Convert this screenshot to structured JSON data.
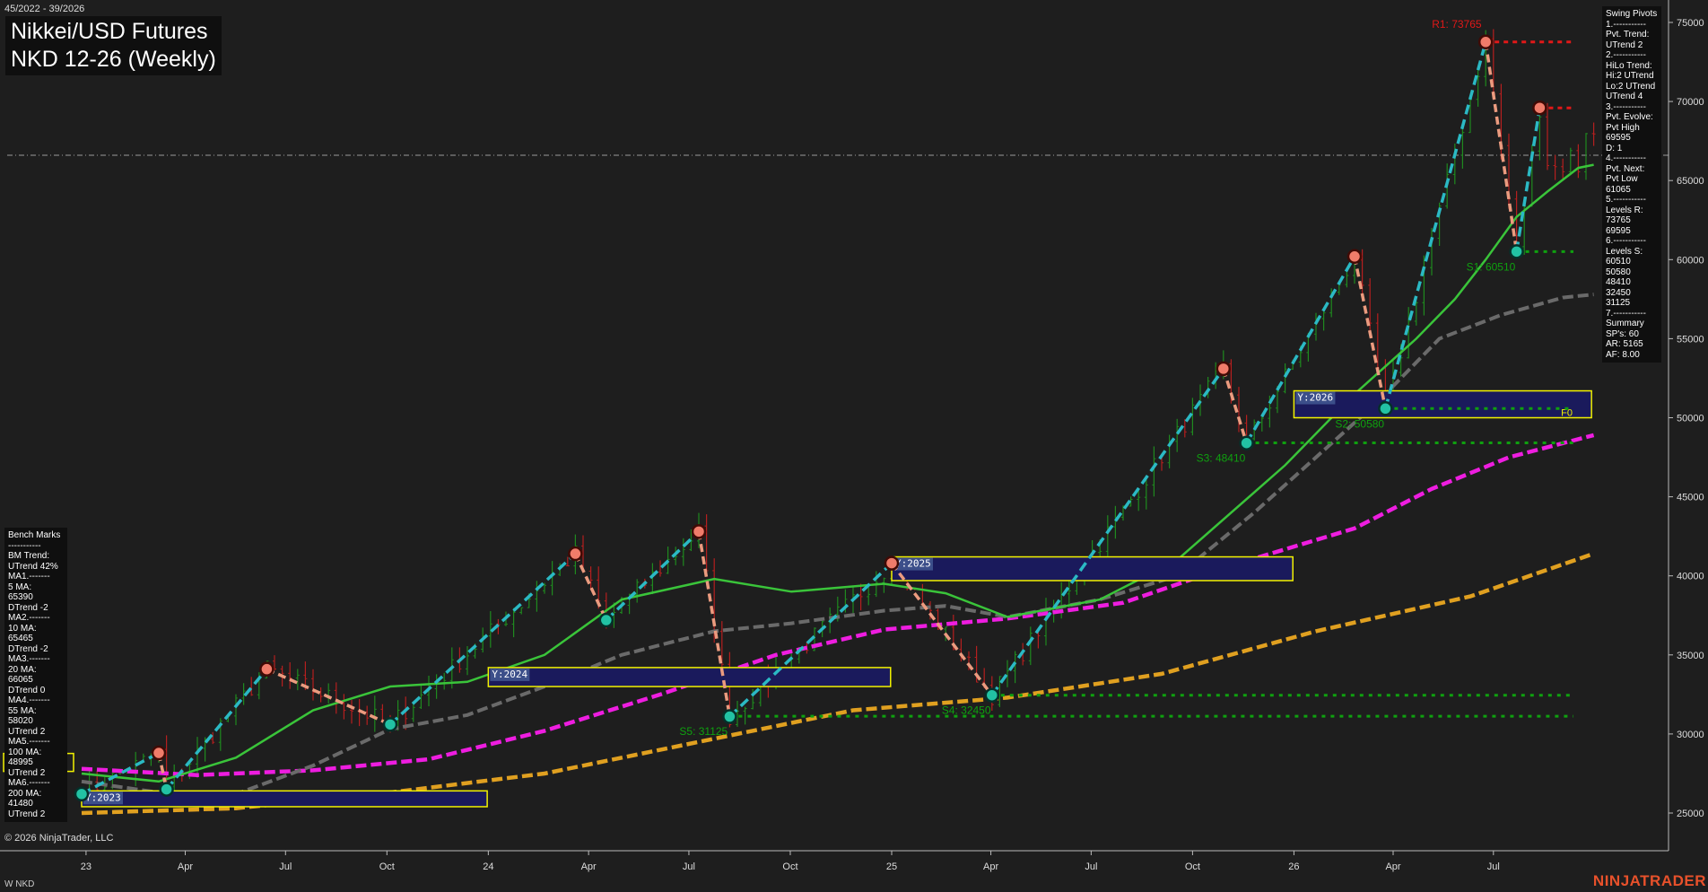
{
  "header": {
    "date_range": "45/2022 - 39/2026",
    "title_line1": "Nikkei/USD Futures",
    "title_line2": "NKD 12-26 (Weekly)"
  },
  "footer": {
    "copyright": "© 2026 NinjaTrader, LLC",
    "instrument": "W NKD",
    "brand": "NINJATRADER"
  },
  "swing_panel": {
    "lines": [
      "Swing Pivots",
      "1.-----------",
      "Pvt. Trend:",
      "UTrend 2",
      "2.-----------",
      "HiLo Trend:",
      "Hi:2 UTrend",
      "Lo:2 UTrend",
      "UTrend 4",
      "3.-----------",
      "Pvt. Evolve:",
      "Pvt High",
      "69595",
      "D: 1",
      "4.-----------",
      "Pvt. Next:",
      "Pvt Low",
      "61065",
      "5.-----------",
      "Levels R:",
      "73765",
      "69595",
      "6.-----------",
      "Levels S:",
      "60510",
      "50580",
      "48410",
      "32450",
      "31125",
      "7.-----------",
      "Summary",
      "SP's: 60",
      "AR: 5165",
      "AF: 8.00"
    ]
  },
  "bench_panel": {
    "lines": [
      "Bench Marks",
      "-----------",
      "BM Trend:",
      "UTrend 42%",
      "MA1.-------",
      "5 MA:",
      "65390",
      "DTrend -2",
      "MA2.-------",
      "10 MA:",
      "65465",
      "DTrend -2",
      "MA3.-------",
      "20 MA:",
      "66065",
      "DTrend 0",
      "MA4.-------",
      "55 MA:",
      "58020",
      "UTrend 2",
      "MA5.-------",
      "100 MA:",
      "48995",
      "UTrend 2",
      "MA6.-------",
      "200 MA:",
      "41480",
      "UTrend 2"
    ]
  },
  "chart_data": {
    "type": "line",
    "title": "NKD 12-26 (Weekly)",
    "ylim": [
      23000,
      76000
    ],
    "y_ticks": [
      25000,
      30000,
      35000,
      40000,
      45000,
      50000,
      55000,
      60000,
      65000,
      70000,
      75000
    ],
    "x_tick_labels": [
      "23",
      "Apr",
      "Jul",
      "Oct",
      "24",
      "Apr",
      "Jul",
      "Oct",
      "25",
      "Apr",
      "Jul",
      "Oct",
      "26",
      "Apr",
      "Jul"
    ],
    "last_price": 66600,
    "colors": {
      "background": "#1e1e1e",
      "up_bar": "#1f8a1f",
      "down_bar": "#b51f1f",
      "ma_fast": "#3ac43a",
      "ma_55": "#6a6a6a",
      "ma_100": "#ee1de0",
      "ma_200": "#e0a020",
      "swing_up": "#2bb9c4",
      "swing_down": "#eb9b7f",
      "resistance": "#e01818",
      "support": "#0fa00f",
      "year_box": "#f2f200",
      "year_fill": "#1a1a5c"
    },
    "swing_pivots": [
      {
        "date": "2022-12-28",
        "value": 26200,
        "type": "low"
      },
      {
        "date": "2023-03-08",
        "value": 28800,
        "type": "high"
      },
      {
        "date": "2023-03-15",
        "value": 26500,
        "type": "low"
      },
      {
        "date": "2023-06-14",
        "value": 34100,
        "type": "high"
      },
      {
        "date": "2023-10-04",
        "value": 30600,
        "type": "low"
      },
      {
        "date": "2024-03-20",
        "value": 41400,
        "type": "high"
      },
      {
        "date": "2024-04-17",
        "value": 37200,
        "type": "low"
      },
      {
        "date": "2024-07-10",
        "value": 42800,
        "type": "high"
      },
      {
        "date": "2024-08-07",
        "value": 31100,
        "type": "low"
      },
      {
        "date": "2025-01-01",
        "value": 40800,
        "type": "high"
      },
      {
        "date": "2025-04-02",
        "value": 32450,
        "type": "low"
      },
      {
        "date": "2025-10-29",
        "value": 53100,
        "type": "high"
      },
      {
        "date": "2025-11-19",
        "value": 48400,
        "type": "low"
      },
      {
        "date": "2026-02-25",
        "value": 60200,
        "type": "high"
      },
      {
        "date": "2026-03-25",
        "value": 50580,
        "type": "low"
      },
      {
        "date": "2026-06-24",
        "value": 73765,
        "type": "high"
      },
      {
        "date": "2026-07-22",
        "value": 60510,
        "type": "low"
      },
      {
        "date": "2026-08-12",
        "value": 69595,
        "type": "high"
      }
    ],
    "resistance_levels": [
      {
        "label": "R1: 73765",
        "value": 73765,
        "start": "2026-06-24"
      },
      {
        "label": "",
        "value": 69595,
        "start": "2026-08-12"
      }
    ],
    "support_levels": [
      {
        "label": "S1: 60510",
        "value": 60510,
        "start": "2026-07-22"
      },
      {
        "label": "S2: 50580",
        "value": 50580,
        "start": "2026-03-25"
      },
      {
        "label": "S3: 48410",
        "value": 48410,
        "start": "2025-11-19"
      },
      {
        "label": "S4: 32450",
        "value": 32450,
        "start": "2025-04-02"
      },
      {
        "label": "S5: 31125",
        "value": 31125,
        "start": "2024-08-07"
      }
    ],
    "year_boxes": [
      {
        "label": "Y:2023",
        "start": "2022-12-28",
        "end": "2023-12-31",
        "low": 25400,
        "high": 26400
      },
      {
        "label": "Y:2024",
        "start": "2024-01-01",
        "end": "2024-12-31",
        "low": 33000,
        "high": 34200
      },
      {
        "label": "Y:2025",
        "start": "2025-01-01",
        "end": "2025-12-31",
        "low": 39700,
        "high": 41200
      },
      {
        "label": "Y:2026",
        "start": "2026-01-01",
        "end": "2026-09-28",
        "low": 50000,
        "high": 51700
      }
    ],
    "year_box_tag": "F0",
    "ma100_box_value": 28200,
    "moving_averages": {
      "ma_fast": [
        [
          0,
          27500
        ],
        [
          10,
          27000
        ],
        [
          20,
          28500
        ],
        [
          30,
          31500
        ],
        [
          40,
          33000
        ],
        [
          50,
          33300
        ],
        [
          60,
          35000
        ],
        [
          70,
          38500
        ],
        [
          82,
          39800
        ],
        [
          92,
          39000
        ],
        [
          104,
          39500
        ],
        [
          112,
          38900
        ],
        [
          120,
          37400
        ],
        [
          132,
          38500
        ],
        [
          142,
          41000
        ],
        [
          156,
          47000
        ],
        [
          165,
          51500
        ],
        [
          173,
          55000
        ],
        [
          178,
          57500
        ],
        [
          182,
          60000
        ],
        [
          186,
          62700
        ],
        [
          190,
          64300
        ],
        [
          194,
          65800
        ],
        [
          196,
          66000
        ]
      ],
      "ma_55": [
        [
          0,
          27000
        ],
        [
          10,
          26300
        ],
        [
          20,
          26200
        ],
        [
          30,
          28000
        ],
        [
          40,
          30300
        ],
        [
          50,
          31200
        ],
        [
          60,
          33000
        ],
        [
          70,
          35000
        ],
        [
          82,
          36500
        ],
        [
          92,
          37000
        ],
        [
          104,
          37800
        ],
        [
          112,
          38100
        ],
        [
          120,
          37400
        ],
        [
          132,
          38500
        ],
        [
          142,
          40000
        ],
        [
          152,
          44000
        ],
        [
          160,
          47500
        ],
        [
          168,
          51000
        ],
        [
          176,
          55000
        ],
        [
          184,
          56500
        ],
        [
          192,
          57600
        ],
        [
          196,
          57800
        ]
      ],
      "ma_100": [
        [
          0,
          27800
        ],
        [
          15,
          27400
        ],
        [
          30,
          27700
        ],
        [
          45,
          28400
        ],
        [
          60,
          30200
        ],
        [
          75,
          32500
        ],
        [
          90,
          35000
        ],
        [
          104,
          36600
        ],
        [
          120,
          37300
        ],
        [
          135,
          38300
        ],
        [
          150,
          40800
        ],
        [
          165,
          43000
        ],
        [
          175,
          45500
        ],
        [
          185,
          47500
        ],
        [
          196,
          48900
        ]
      ],
      "ma_200": [
        [
          0,
          25000
        ],
        [
          20,
          25300
        ],
        [
          40,
          26300
        ],
        [
          60,
          27500
        ],
        [
          80,
          29500
        ],
        [
          100,
          31500
        ],
        [
          120,
          32300
        ],
        [
          140,
          33800
        ],
        [
          160,
          36500
        ],
        [
          180,
          38700
        ],
        [
          196,
          41400
        ]
      ]
    }
  }
}
